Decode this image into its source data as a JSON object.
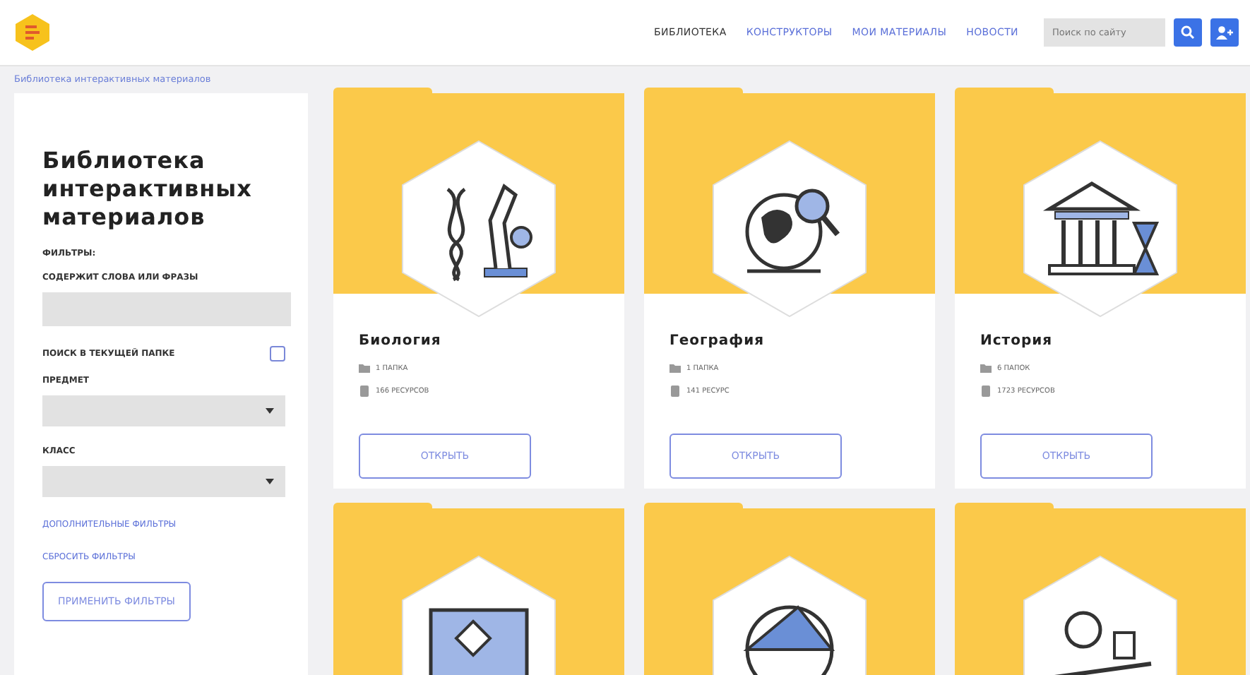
{
  "header": {
    "nav": [
      {
        "label": "БИБЛИОТЕКА",
        "selected": true
      },
      {
        "label": "КОНСТРУКТОРЫ",
        "selected": false
      },
      {
        "label": "МОИ МАТЕРИАЛЫ",
        "selected": false
      },
      {
        "label": "НОВОСТИ",
        "selected": false
      }
    ],
    "search": {
      "placeholder": "Поиск по сайту"
    }
  },
  "breadcrumb": "Библиотека интерактивных материалов",
  "sidebar": {
    "title": "Библиотека интерактивных материалов",
    "filters_label": "ФИЛЬТРЫ:",
    "words_label": "СОДЕРЖИТ СЛОВА ИЛИ ФРАЗЫ",
    "current_folder": {
      "label": "ПОИСК В ТЕКУЩЕЙ ПАПКЕ",
      "checked": false
    },
    "subject_label": "ПРЕДМЕТ",
    "grade_label": "КЛАСС",
    "more_filters": "ДОПОЛНИТЕЛЬНЫЕ ФИЛЬТРЫ",
    "reset_filters": "СБРОСИТЬ ФИЛЬТРЫ",
    "apply_button": "ПРИМЕНИТЬ ФИЛЬТРЫ"
  },
  "cards": [
    {
      "kind": "biology",
      "title": "Биология",
      "folders": "1 ПАПКА",
      "resources": "166 РЕСУРСОВ",
      "button": "ОТКРЫТЬ"
    },
    {
      "kind": "geography",
      "title": "География",
      "folders": "1 ПАПКА",
      "resources": "141 РЕСУРС",
      "button": "ОТКРЫТЬ"
    },
    {
      "kind": "history",
      "title": "История",
      "folders": "6 ПАПОК",
      "resources": "1723 РЕСУРСОВ",
      "button": "ОТКРЫТЬ"
    },
    {
      "kind": "informatics"
    },
    {
      "kind": "geometry"
    },
    {
      "kind": "physics"
    }
  ]
}
